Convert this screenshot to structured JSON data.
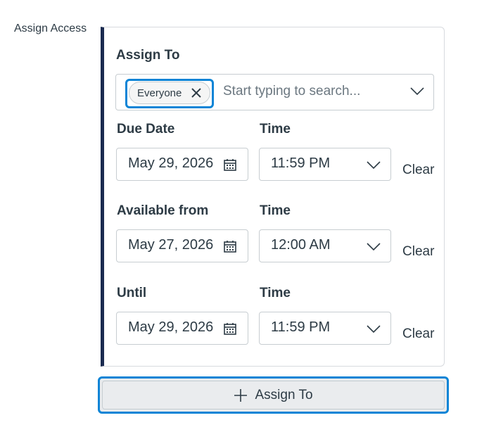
{
  "side_label": "Assign Access",
  "assign_to": {
    "label": "Assign To",
    "chip": "Everyone",
    "placeholder": "Start typing to search..."
  },
  "rows": [
    {
      "date_label": "Due Date",
      "time_label": "Time",
      "date": "May 29, 2026",
      "time": "11:59 PM",
      "clear": "Clear"
    },
    {
      "date_label": "Available from",
      "time_label": "Time",
      "date": "May 27, 2026",
      "time": "12:00 AM",
      "clear": "Clear"
    },
    {
      "date_label": "Until",
      "time_label": "Time",
      "date": "May 29, 2026",
      "time": "11:59 PM",
      "clear": "Clear"
    }
  ],
  "add_button": "Assign To",
  "icons": {
    "chip_remove": "close-icon",
    "dropdown": "chevron-down-icon",
    "calendar": "calendar-icon",
    "add": "plus-icon"
  },
  "colors": {
    "accent_border": "#1b2b50",
    "focus": "#0b84d6",
    "text": "#2d3b45"
  }
}
